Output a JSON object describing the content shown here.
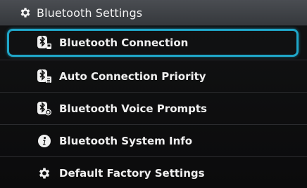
{
  "header": {
    "title": "Bluetooth Settings",
    "icon": "gear-icon"
  },
  "menu": {
    "items": [
      {
        "label": "Bluetooth Connection",
        "icon": "bluetooth-connection-icon",
        "selected": true
      },
      {
        "label": "Auto Connection Priority",
        "icon": "bluetooth-priority-icon",
        "selected": false
      },
      {
        "label": "Bluetooth Voice Prompts",
        "icon": "bluetooth-voice-icon",
        "selected": false
      },
      {
        "label": "Bluetooth System Info",
        "icon": "info-icon",
        "selected": false
      },
      {
        "label": "Default Factory Settings",
        "icon": "gear-icon",
        "selected": false
      }
    ]
  },
  "colors": {
    "accent": "#1fa7c9",
    "title_bar": "#3f4246",
    "background": "#0e0f10"
  }
}
